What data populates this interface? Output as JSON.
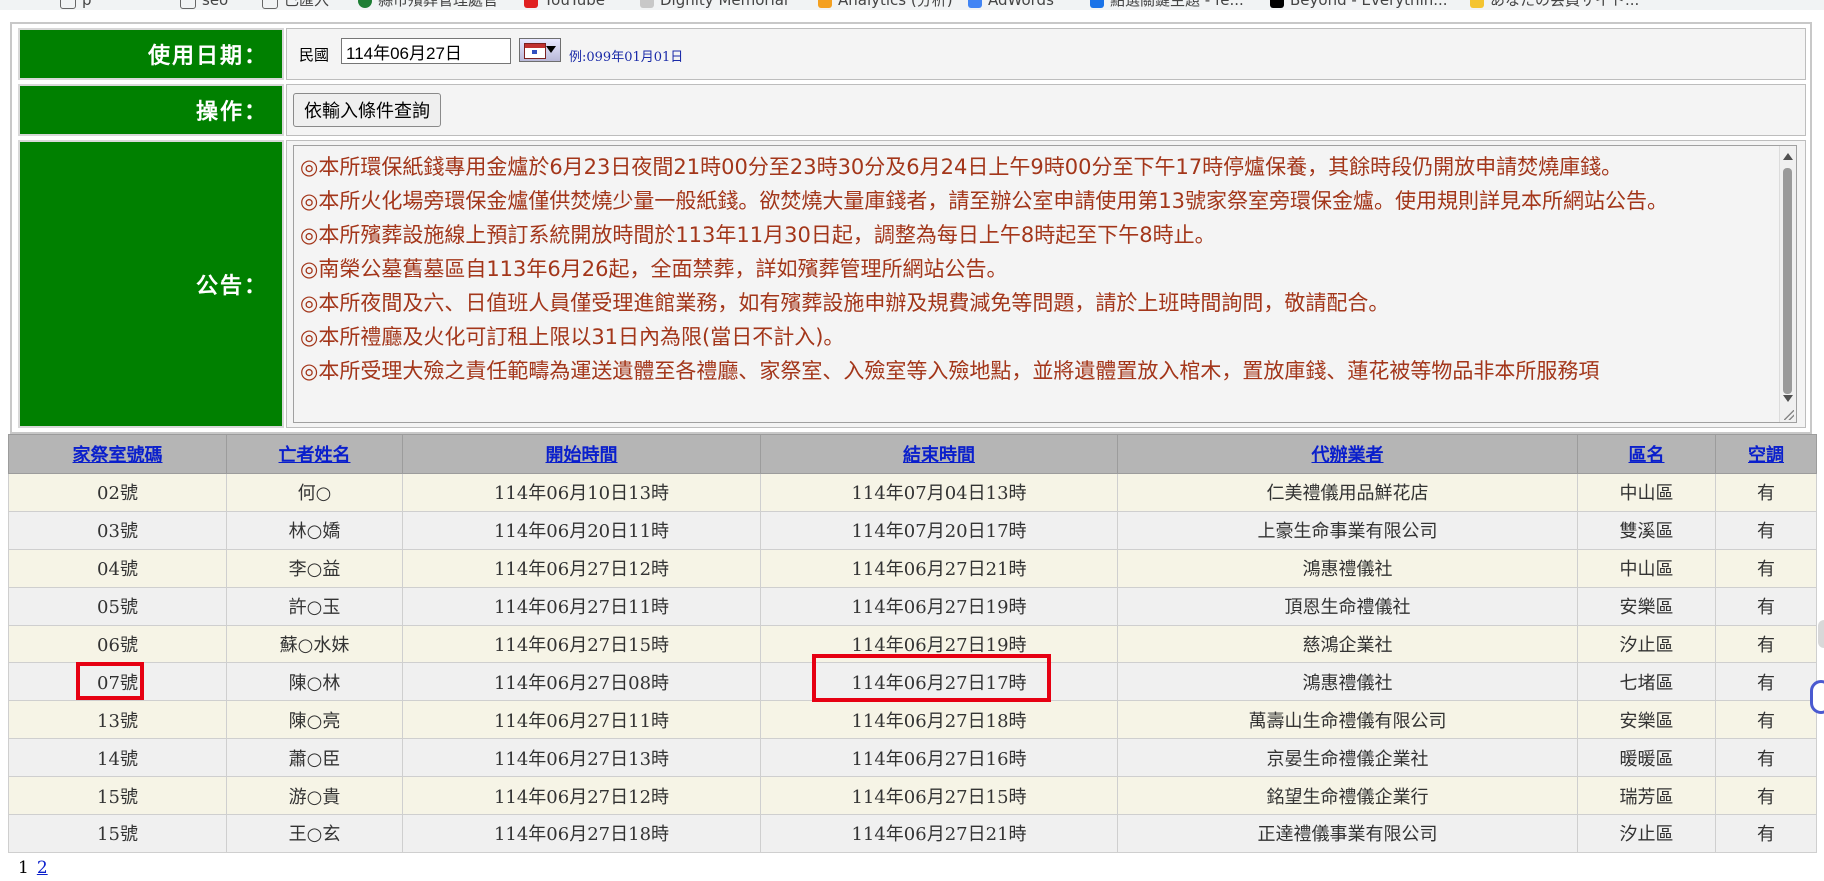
{
  "bookmarks": [
    {
      "label": "p",
      "color": "#ffffff"
    },
    {
      "label": "seo",
      "color": "#ffffff"
    },
    {
      "label": "已匯入",
      "color": "#ffffff"
    },
    {
      "label": "縣市殯葬管理處官",
      "color": "#1e7e34"
    },
    {
      "label": "YouTube",
      "color": "#e02020"
    },
    {
      "label": "Dignity Memorial",
      "color": "#c8c8c8"
    },
    {
      "label": "Analytics (分析)",
      "color": "#f4a020"
    },
    {
      "label": "AdWords",
      "color": "#4285f4"
    },
    {
      "label": "點選關鍵主題 - fe...",
      "color": "#1a73e8"
    },
    {
      "label": "Beyond - Everythin...",
      "color": "#000000"
    },
    {
      "label": "あなたの会員サイト...",
      "color": "#f4c430"
    }
  ],
  "form": {
    "date_label": "使用日期：",
    "era": "民國",
    "date_value": "114年06月27日",
    "date_example": "例:099年01月01日",
    "op_label": "操作：",
    "query_button": "依輸入條件查詢",
    "notice_label": "公告："
  },
  "notices": [
    "◎本所環保紙錢專用金爐於6月23日夜間21時00分至23時30分及6月24日上午9時00分至下午17時停爐保養，其餘時段仍開放申請焚燒庫錢。",
    "◎本所火化場旁環保金爐僅供焚燒少量一般紙錢。欲焚燒大量庫錢者，請至辦公室申請使用第13號家祭室旁環保金爐。使用規則詳見本所網站公告。",
    "◎本所殯葬設施線上預訂系統開放時間於113年11月30日起，調整為每日上午8時起至下午8時止。",
    "◎南榮公墓舊墓區自113年6月26起，全面禁葬，詳如殯葬管理所網站公告。",
    "◎本所夜間及六、日值班人員僅受理進館業務，如有殯葬設施申辦及規費減免等問題，請於上班時間詢問，敬請配合。",
    "◎本所禮廳及火化可訂租上限以31日內為限(當日不計入)。",
    "◎本所受理大殮之責任範疇為運送遺體至各禮廳、家祭室、入殮室等入殮地點，並將遺體置放入棺木，置放庫錢、蓮花被等物品非本所服務項"
  ],
  "table": {
    "headers": [
      "家祭室號碼",
      "亡者姓名",
      "開始時間",
      "結束時間",
      "代辦業者",
      "區名",
      "空調"
    ],
    "rows": [
      [
        "02號",
        "何○",
        "114年06月10日13時",
        "114年07月04日13時",
        "仁美禮儀用品鮮花店",
        "中山區",
        "有"
      ],
      [
        "03號",
        "林○嬌",
        "114年06月20日11時",
        "114年07月20日17時",
        "上豪生命事業有限公司",
        "雙溪區",
        "有"
      ],
      [
        "04號",
        "李○益",
        "114年06月27日12時",
        "114年06月27日21時",
        "鴻惠禮儀社",
        "中山區",
        "有"
      ],
      [
        "05號",
        "許○玉",
        "114年06月27日11時",
        "114年06月27日19時",
        "頂恩生命禮儀社",
        "安樂區",
        "有"
      ],
      [
        "06號",
        "蘇○水妹",
        "114年06月27日15時",
        "114年06月27日19時",
        "慈鴻企業社",
        "汐止區",
        "有"
      ],
      [
        "07號",
        "陳○林",
        "114年06月27日08時",
        "114年06月27日17時",
        "鴻惠禮儀社",
        "七堵區",
        "有"
      ],
      [
        "13號",
        "陳○亮",
        "114年06月27日11時",
        "114年06月27日18時",
        "萬壽山生命禮儀有限公司",
        "安樂區",
        "有"
      ],
      [
        "14號",
        "蕭○臣",
        "114年06月27日13時",
        "114年06月27日16時",
        "京晏生命禮儀企業社",
        "暖暖區",
        "有"
      ],
      [
        "15號",
        "游○貴",
        "114年06月27日12時",
        "114年06月27日15時",
        "銘望生命禮儀企業行",
        "瑞芳區",
        "有"
      ],
      [
        "15號",
        "王○玄",
        "114年06月27日18時",
        "114年06月27日21時",
        "正達禮儀事業有限公司",
        "汐止區",
        "有"
      ]
    ]
  },
  "pagination": {
    "current": "1",
    "next": "2"
  },
  "highlight_color": "#e60012"
}
